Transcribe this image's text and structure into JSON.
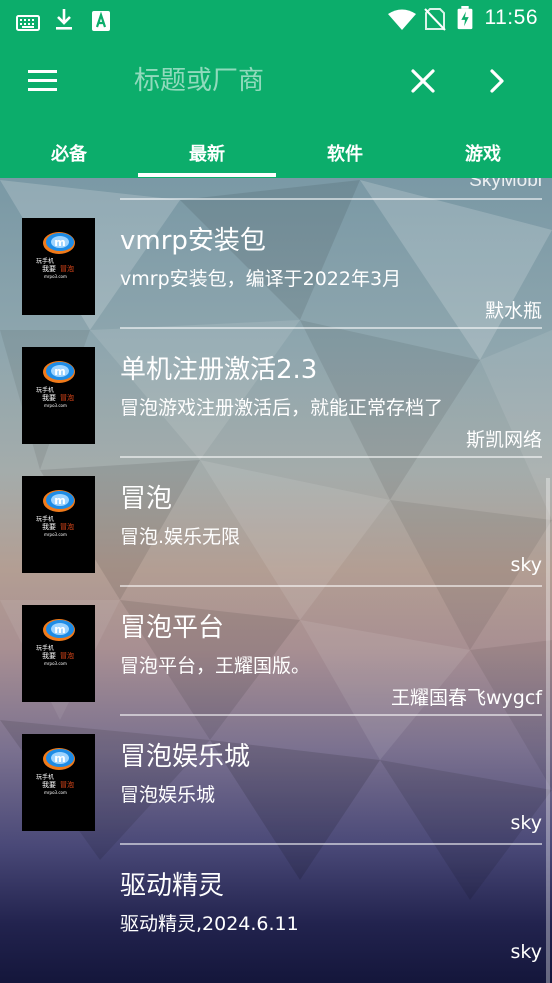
{
  "status_bar": {
    "time": "11:56",
    "left_icons": [
      "keyboard-icon",
      "download-icon",
      "android-a-icon"
    ],
    "right_icons": [
      "wifi-icon",
      "no-sim-icon",
      "battery-charging-icon"
    ]
  },
  "toolbar": {
    "search_placeholder": "标题或厂商",
    "menu_icon": "hamburger-icon",
    "clear_icon": "close-icon",
    "next_icon": "chevron-right-icon"
  },
  "tabs": [
    {
      "label": "必备",
      "active": false
    },
    {
      "label": "最新",
      "active": true
    },
    {
      "label": "软件",
      "active": false
    },
    {
      "label": "游戏",
      "active": false
    }
  ],
  "list": {
    "partial_author": "SkyMobi",
    "items": [
      {
        "title": "vmrp安装包",
        "desc": "vmrp安装包，编译于2022年3月",
        "author": "默水瓶",
        "has_thumb": true
      },
      {
        "title": "单机注册激活2.3",
        "desc": "冒泡游戏注册激活后，就能正常存档了",
        "author": "斯凯网络",
        "has_thumb": true
      },
      {
        "title": "冒泡",
        "desc": "冒泡.娱乐无限",
        "author": "sky",
        "has_thumb": true
      },
      {
        "title": "冒泡平台",
        "desc": "冒泡平台，王耀国版。",
        "author": "王耀国春飞wygcf",
        "has_thumb": true
      },
      {
        "title": "冒泡娱乐城",
        "desc": "冒泡娱乐城",
        "author": "sky",
        "has_thumb": true
      },
      {
        "title": "驱动精灵",
        "desc": "驱动精灵,2024.6.11",
        "author": "sky",
        "has_thumb": false
      }
    ],
    "thumb_text": {
      "line1": "玩手机",
      "line2": "我要",
      "line3": "冒泡",
      "line4": "mrpo3.com",
      "logo_letter": "m"
    }
  },
  "colors": {
    "primary": "#0cad6b",
    "thumb_bg": "#000000",
    "thumb_logo_blue": "#1e8ce6",
    "thumb_logo_orange": "#f07a1a",
    "thumb_text_red": "#e84b1c"
  }
}
